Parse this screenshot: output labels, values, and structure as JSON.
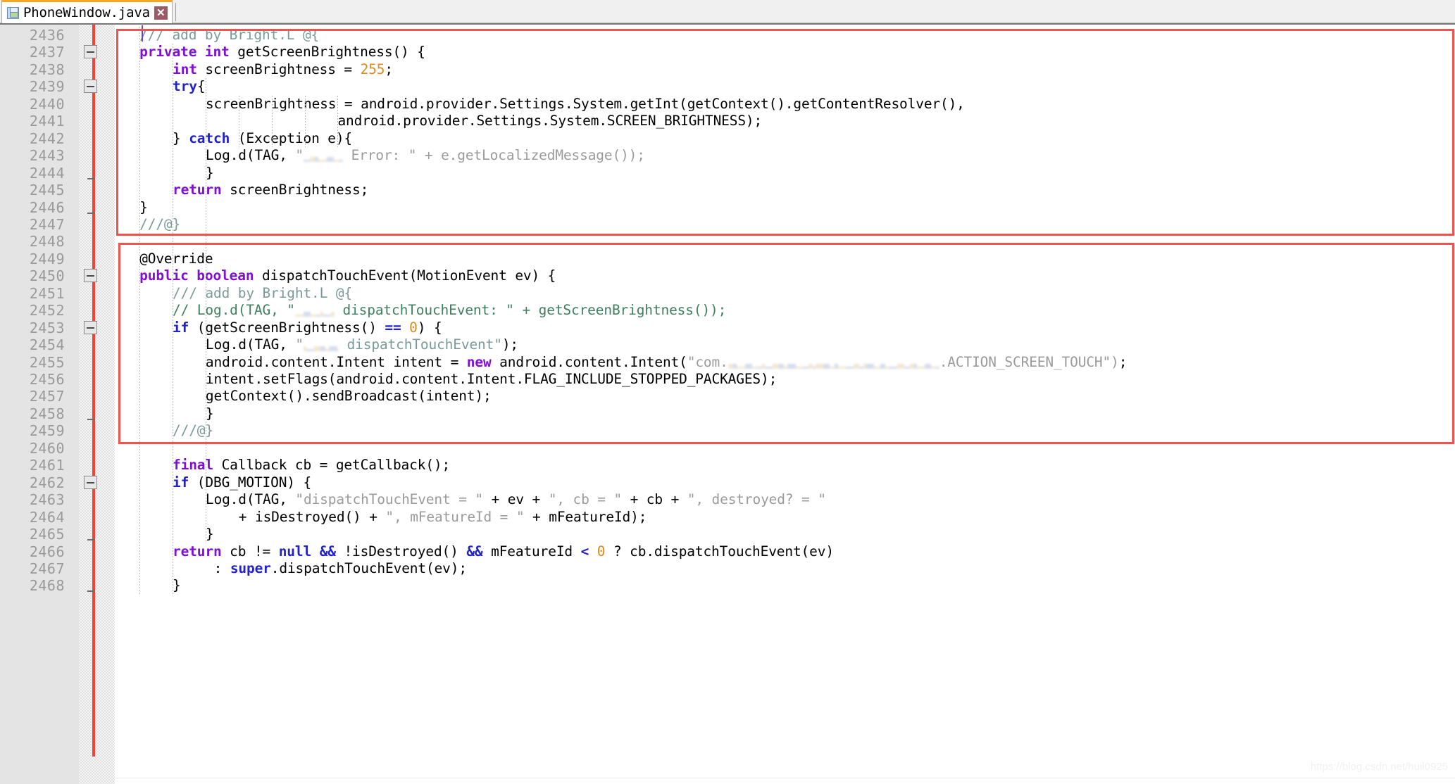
{
  "window": {
    "tab_title": "PhoneWindow.java",
    "tab_close_label": "✕",
    "save_icon_name": "save-icon"
  },
  "editor": {
    "accent_red": "#ef5350",
    "current_line_color": "#e3e3f7",
    "caret_color": "#6d3fd4",
    "gutter_bg": "#e4e4e4",
    "line_number_color": "#9a9a9a",
    "first_line_number": 2436,
    "last_line_number": 2468
  },
  "lines": [
    {
      "n": "2436",
      "indent": 0,
      "fold": "none"
    },
    {
      "n": "2437",
      "indent": 0,
      "fold": "minus"
    },
    {
      "n": "2438",
      "indent": 0,
      "fold": "none"
    },
    {
      "n": "2439",
      "indent": 0,
      "fold": "minus"
    },
    {
      "n": "2440",
      "indent": 0,
      "fold": "none"
    },
    {
      "n": "2441",
      "indent": 0,
      "fold": "none"
    },
    {
      "n": "2442",
      "indent": 0,
      "fold": "none"
    },
    {
      "n": "2443",
      "indent": 0,
      "fold": "none"
    },
    {
      "n": "2444",
      "indent": 0,
      "fold": "tick"
    },
    {
      "n": "2445",
      "indent": 0,
      "fold": "none"
    },
    {
      "n": "2446",
      "indent": 0,
      "fold": "tick"
    },
    {
      "n": "2447",
      "indent": 0,
      "fold": "none"
    },
    {
      "n": "2448",
      "indent": 0,
      "fold": "none"
    },
    {
      "n": "2449",
      "indent": 0,
      "fold": "none"
    },
    {
      "n": "2450",
      "indent": 0,
      "fold": "minus"
    },
    {
      "n": "2451",
      "indent": 0,
      "fold": "none"
    },
    {
      "n": "2452",
      "indent": 0,
      "fold": "none"
    },
    {
      "n": "2453",
      "indent": 0,
      "fold": "minus"
    },
    {
      "n": "2454",
      "indent": 0,
      "fold": "none"
    },
    {
      "n": "2455",
      "indent": 0,
      "fold": "none"
    },
    {
      "n": "2456",
      "indent": 0,
      "fold": "none"
    },
    {
      "n": "2457",
      "indent": 0,
      "fold": "none"
    },
    {
      "n": "2458",
      "indent": 0,
      "fold": "tick"
    },
    {
      "n": "2459",
      "indent": 0,
      "fold": "none"
    },
    {
      "n": "2460",
      "indent": 0,
      "fold": "none"
    },
    {
      "n": "2461",
      "indent": 0,
      "fold": "none"
    },
    {
      "n": "2462",
      "indent": 0,
      "fold": "minus"
    },
    {
      "n": "2463",
      "indent": 0,
      "fold": "none"
    },
    {
      "n": "2464",
      "indent": 0,
      "fold": "none"
    },
    {
      "n": "2465",
      "indent": 0,
      "fold": "tick"
    },
    {
      "n": "2466",
      "indent": 0,
      "fold": "none"
    },
    {
      "n": "2467",
      "indent": 0,
      "fold": "none"
    },
    {
      "n": "2468",
      "indent": 0,
      "fold": "tick"
    }
  ],
  "code": {
    "l2436": "/// add by Bright.L @{",
    "l2437": "private int getScreenBrightness() {",
    "l2438": "int screenBrightness = 255;",
    "l2439": "try{",
    "l2440": "screenBrightness = android.provider.Settings.System.getInt(getContext().getContentResolver(),",
    "l2441": "android.provider.Settings.System.SCREEN_BRIGHTNESS);",
    "l2442": "} catch (Exception e){",
    "l2443_a": "Log.d(TAG, \"",
    "l2443_b": " Error: \" + e.getLocalizedMessage());",
    "l2444": "}",
    "l2445": "return screenBrightness;",
    "l2446": "}",
    "l2447": "///@}",
    "l2448": "",
    "l2449": "@Override",
    "l2450": "public boolean dispatchTouchEvent(MotionEvent ev) {",
    "l2451": "/// add by Bright.L @{",
    "l2452_a": "// Log.d(TAG, \"",
    "l2452_b": " dispatchTouchEvent: \" + getScreenBrightness());",
    "l2453": "if (getScreenBrightness() == 0) {",
    "l2454_a": "Log.d(TAG, \"",
    "l2454_b": " dispatchTouchEvent\");",
    "l2455_a": "android.content.Intent intent = new android.content.Intent(\"com.",
    "l2455_b": ".ACTION_SCREEN_TOUCH\");",
    "l2456": "intent.setFlags(android.content.Intent.FLAG_INCLUDE_STOPPED_PACKAGES);",
    "l2457": "getContext().sendBroadcast(intent);",
    "l2458": "}",
    "l2459": "///@}",
    "l2460": "",
    "l2461": "final Callback cb = getCallback();",
    "l2462": "if (DBG_MOTION) {",
    "l2463": "Log.d(TAG, \"dispatchTouchEvent = \" + ev + \", cb = \" + cb + \", destroyed? = \"",
    "l2464": "+ isDestroyed() + \", mFeatureId = \" + mFeatureId);",
    "l2465": "}",
    "l2466": "return cb != null && !isDestroyed() && mFeatureId < 0 ? cb.dispatchTouchEvent(ev)",
    "l2467": ": super.dispatchTouchEvent(ev);",
    "l2468": "}"
  },
  "annotations": [
    {
      "name": "annotation-box-brightness-method",
      "label": "red box around getScreenBrightness block"
    },
    {
      "name": "annotation-box-dispatch-touch",
      "label": "red box around dispatchTouchEvent block"
    }
  ],
  "watermark": {
    "text": "https://blog.csdn.net/huil0925"
  }
}
